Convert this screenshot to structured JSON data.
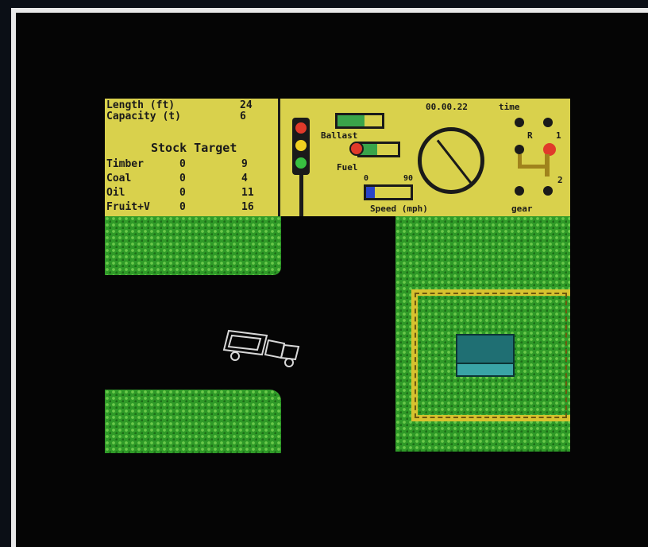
{
  "hud": {
    "length_label": "Length (ft)",
    "length_value": "24",
    "capacity_label": "Capacity (t)",
    "capacity_value": "6",
    "stock_header": "Stock Target",
    "stock_rows": [
      {
        "name": "Timber",
        "stock": "0",
        "target": "9"
      },
      {
        "name": "Coal",
        "stock": "0",
        "target": "4"
      },
      {
        "name": "Oil",
        "stock": "0",
        "target": "11"
      },
      {
        "name": "Fruit+V",
        "stock": "0",
        "target": "16"
      }
    ],
    "ballast_label": "Ballast",
    "fuel_label": "Fuel",
    "speed_min": "0",
    "speed_max": "90",
    "speed_label": "Speed (mph)",
    "time_value": "00.00.22",
    "time_label": "time",
    "gear_label": "gear",
    "gear_r": "R",
    "gear_1": "1",
    "gear_2": "2",
    "ballast_level": 0.6,
    "fuel_level": 0.45,
    "speed_level": 0.2
  },
  "colors": {
    "hud_bg": "#d9d14c",
    "grass": "#2f9a28",
    "signal_red": "#e03a2a",
    "signal_yellow": "#f0d020",
    "signal_green": "#38c040",
    "gauge_green": "#3aa44a",
    "speed_blue": "#2a44c8",
    "track_yellow": "#d7c22e",
    "depot_teal": "#1f6f73"
  }
}
